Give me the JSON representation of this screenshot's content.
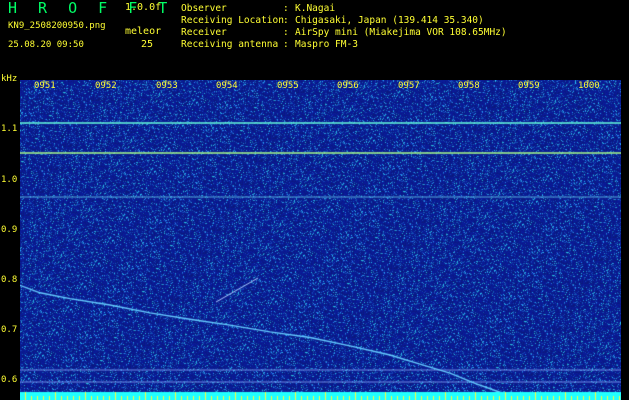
{
  "header": {
    "app_title": "H R O F F T",
    "version": "1.0.0f",
    "filename": "KN9_2508200950.png",
    "mode": "meleor",
    "datetime": "25.08.20 09:50",
    "count": "25"
  },
  "info": [
    {
      "key": "Observer",
      "value": "K.Nagai"
    },
    {
      "key": "Receiving Location",
      "value": "Chigasaki, Japan (139.414 35.340)"
    },
    {
      "key": "Receiver",
      "value": "AirSpy mini (Miakejima VOR 108.65MHz)"
    },
    {
      "key": "Receiving antenna",
      "value": "Maspro FM-3"
    }
  ],
  "axis": {
    "unit": "kHz",
    "y_ticks": [
      "1.1",
      "1.0",
      "0.9",
      "0.8",
      "0.7",
      "0.6"
    ],
    "x_ticks": [
      "0951",
      "0952",
      "0953",
      "0954",
      "0955",
      "0956",
      "0957",
      "0958",
      "0959",
      "1000"
    ]
  },
  "colors": {
    "background": "#000000",
    "plot_bg": "#0b1f8a",
    "label": "#ffff33",
    "title": "#00ff66",
    "carrier": "#66ffcc"
  }
}
